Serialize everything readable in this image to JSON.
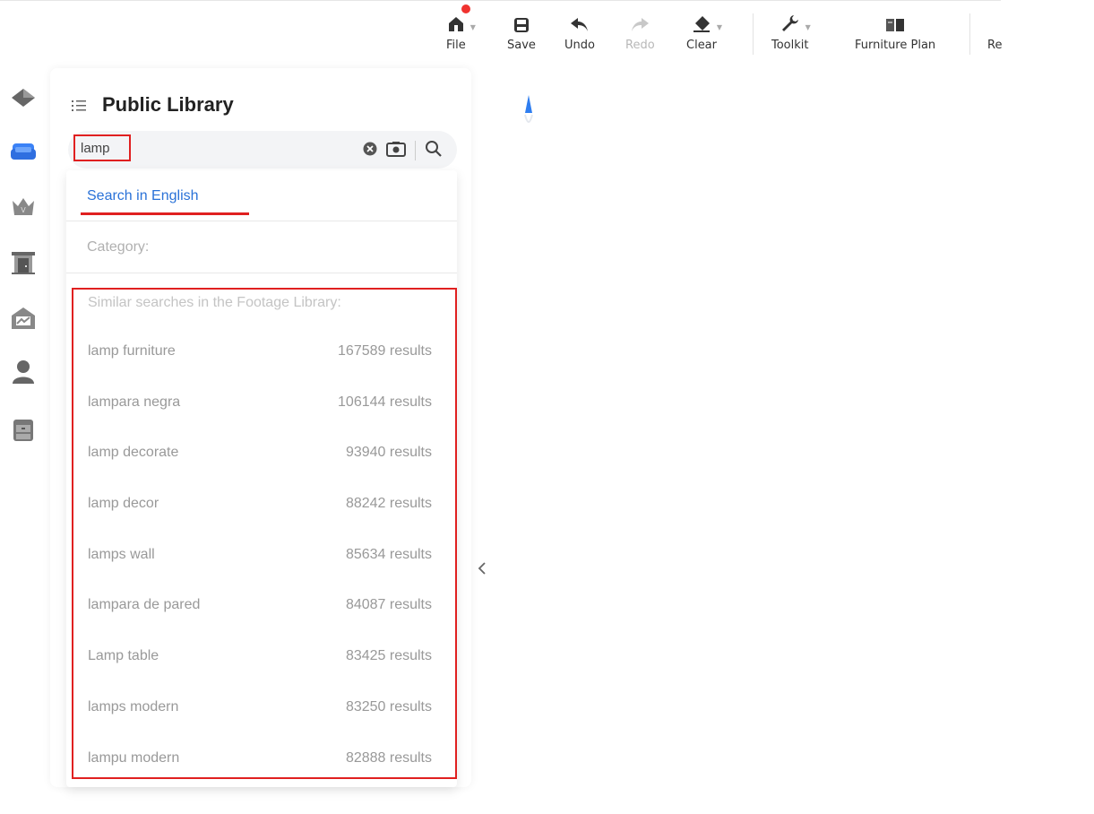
{
  "toolbar": {
    "file": "File",
    "save": "Save",
    "undo": "Undo",
    "redo": "Redo",
    "clear": "Clear",
    "toolkit": "Toolkit",
    "furniture_plan": "Furniture Plan",
    "overflow": "Re"
  },
  "panel": {
    "title": "Public Library",
    "search_value": "lamp"
  },
  "dropdown": {
    "lang_option": "Search in English",
    "category_label": "Category:",
    "similar_header": "Similar searches in the Footage Library:",
    "suggestions": [
      {
        "term": "lamp furniture",
        "count": "167589 results"
      },
      {
        "term": "lampara negra",
        "count": "106144 results"
      },
      {
        "term": "lamp decorate",
        "count": "93940 results"
      },
      {
        "term": "lamp decor",
        "count": "88242 results"
      },
      {
        "term": "lamps wall",
        "count": "85634 results"
      },
      {
        "term": "lampara de pared",
        "count": "84087 results"
      },
      {
        "term": "Lamp table",
        "count": "83425 results"
      },
      {
        "term": "lamps modern",
        "count": "83250 results"
      },
      {
        "term": "lampu modern",
        "count": "82888 results"
      }
    ]
  },
  "colors": {
    "accent_blue": "#2a72d8",
    "highlight_red": "#e02020",
    "notification_dot": "#f0322f",
    "rail_active": "#3b82f6"
  }
}
